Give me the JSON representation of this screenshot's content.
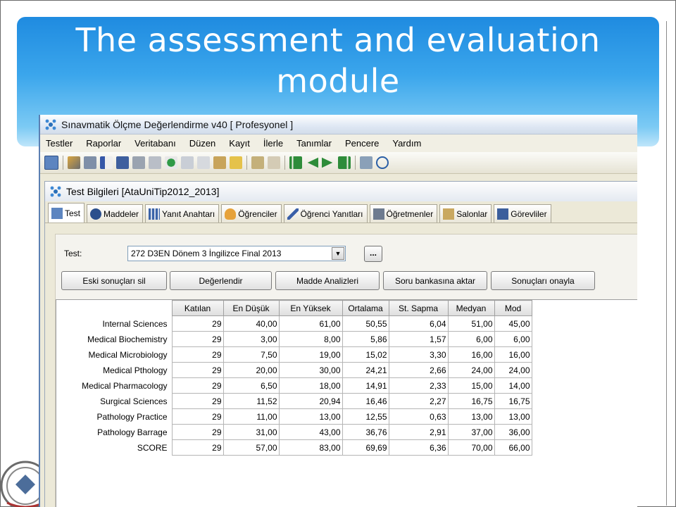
{
  "slide": {
    "title": "The assessment and evaluation module"
  },
  "app": {
    "title": "Sınavmatik Ölçme Değerlendirme v40 [ Profesyonel ]",
    "menu": [
      "Testler",
      "Raporlar",
      "Veritabanı",
      "Düzen",
      "Kayıt",
      "İlerle",
      "Tanımlar",
      "Pencere",
      "Yardım"
    ],
    "toolbar_icons": [
      "calendar-icon",
      "wrench-icon",
      "cube-icon",
      "sort-az-icon",
      "save-icon",
      "print-icon",
      "print-preview-icon",
      "search-icon",
      "cut-icon",
      "copy-icon",
      "paste-icon",
      "undo-icon",
      "import-icon",
      "eraser-icon",
      "first-icon",
      "previous-icon",
      "next-icon",
      "last-icon",
      "tree-icon",
      "help-icon"
    ]
  },
  "child_window": {
    "title": "Test Bilgileri [AtaUniTip2012_2013]",
    "tabs": [
      {
        "label": "Test",
        "icon": "calendar-icon"
      },
      {
        "label": "Maddeler",
        "icon": "question-icon"
      },
      {
        "label": "Yanıt Anahtarı",
        "icon": "grid-icon"
      },
      {
        "label": "Öğrenciler",
        "icon": "user-icon"
      },
      {
        "label": "Öğrenci Yanıtları",
        "icon": "pen-icon"
      },
      {
        "label": "Öğretmenler",
        "icon": "teacher-icon"
      },
      {
        "label": "Salonlar",
        "icon": "door-icon"
      },
      {
        "label": "Görevliler",
        "icon": "staff-icon"
      }
    ]
  },
  "form": {
    "test_label": "Test:",
    "test_value": "272 D3EN Dönem 3 İngilizce Final 2013",
    "browse_label": "...",
    "buttons": {
      "delete_results": "Eski sonuçları sil",
      "evaluate": "Değerlendir",
      "item_analysis": "Madde Analizleri",
      "transfer_bank": "Soru bankasına aktar",
      "approve_results": "Sonuçları onayla"
    }
  },
  "grid": {
    "columns": [
      "Katılan",
      "En Düşük",
      "En Yüksek",
      "Ortalama",
      "St. Sapma",
      "Medyan",
      "Mod"
    ],
    "rows": [
      {
        "label": "Internal Sciences",
        "values": [
          "29",
          "40,00",
          "61,00",
          "50,55",
          "6,04",
          "51,00",
          "45,00"
        ]
      },
      {
        "label": "Medical Biochemistry",
        "values": [
          "29",
          "3,00",
          "8,00",
          "5,86",
          "1,57",
          "6,00",
          "6,00"
        ]
      },
      {
        "label": "Medical Microbiology",
        "values": [
          "29",
          "7,50",
          "19,00",
          "15,02",
          "3,30",
          "16,00",
          "16,00"
        ]
      },
      {
        "label": "Medical Pthology",
        "values": [
          "29",
          "20,00",
          "30,00",
          "24,21",
          "2,66",
          "24,00",
          "24,00"
        ]
      },
      {
        "label": "Medical Pharmacology",
        "values": [
          "29",
          "6,50",
          "18,00",
          "14,91",
          "2,33",
          "15,00",
          "14,00"
        ]
      },
      {
        "label": "Surgical Sciences",
        "values": [
          "29",
          "11,52",
          "20,94",
          "16,46",
          "2,27",
          "16,75",
          "16,75"
        ]
      },
      {
        "label": "Pathology Practice",
        "values": [
          "29",
          "11,00",
          "13,00",
          "12,55",
          "0,63",
          "13,00",
          "13,00"
        ]
      },
      {
        "label": "Pathology Barrage",
        "values": [
          "29",
          "31,00",
          "43,00",
          "36,76",
          "2,91",
          "37,00",
          "36,00"
        ]
      },
      {
        "label": "SCORE",
        "values": [
          "29",
          "57,00",
          "83,00",
          "69,69",
          "6,36",
          "70,00",
          "66,00"
        ]
      }
    ]
  },
  "colors": {
    "banner_top": "#1f8be0",
    "banner_bottom": "#bfe5fa",
    "window_bg": "#ece9d8"
  }
}
